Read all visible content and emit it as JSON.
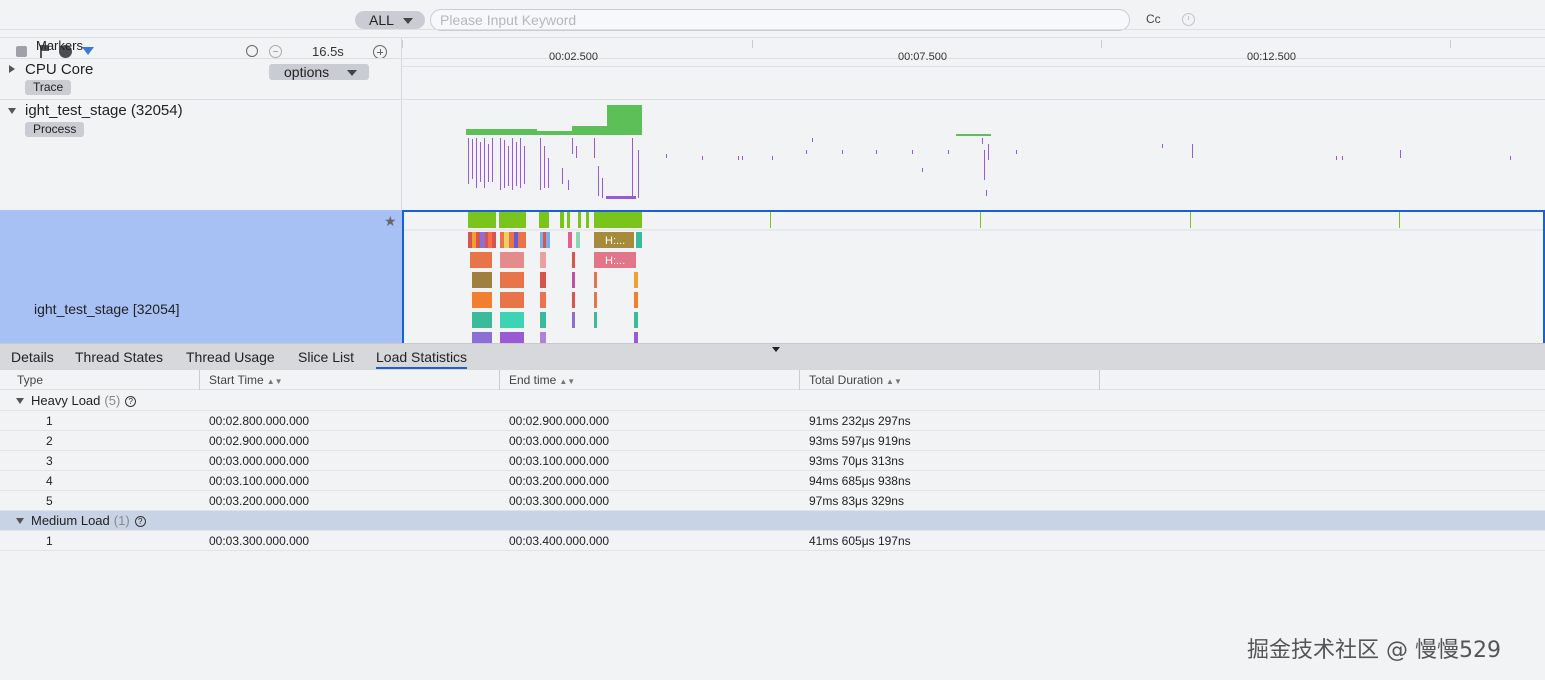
{
  "search": {
    "scope": "ALL",
    "placeholder": "Please Input Keyword",
    "case_label": "Cc"
  },
  "toolbar": {
    "zoom": "16.5s"
  },
  "ruler": {
    "ticks": [
      "00:02.500",
      "00:07.500",
      "00:12.500"
    ]
  },
  "rows": {
    "markers": "Markers",
    "cpu": {
      "title": "CPU Core",
      "tag": "Trace",
      "options": "options"
    },
    "process": {
      "title": "ight_test_stage (32054)",
      "tag": "Process"
    },
    "thread": {
      "title": "ight_test_stage [32054]",
      "slice_label_1": "H:...",
      "slice_label_2": "H:..."
    }
  },
  "tabs": [
    "Details",
    "Thread States",
    "Thread Usage",
    "Slice List",
    "Load Statistics"
  ],
  "table": {
    "columns": [
      "Type",
      "Start Time",
      "End time",
      "Total Duration"
    ],
    "groups": [
      {
        "name": "Heavy Load",
        "count": "(5)",
        "rows": [
          {
            "id": "1",
            "start": "00:02.800.000.000",
            "end": "00:02.900.000.000",
            "duration": "91ms 232μs 297ns"
          },
          {
            "id": "2",
            "start": "00:02.900.000.000",
            "end": "00:03.000.000.000",
            "duration": "93ms 597μs 919ns"
          },
          {
            "id": "3",
            "start": "00:03.000.000.000",
            "end": "00:03.100.000.000",
            "duration": "93ms 70μs 313ns"
          },
          {
            "id": "4",
            "start": "00:03.100.000.000",
            "end": "00:03.200.000.000",
            "duration": "94ms 685μs 938ns"
          },
          {
            "id": "5",
            "start": "00:03.200.000.000",
            "end": "00:03.300.000.000",
            "duration": "97ms 83μs 329ns"
          }
        ]
      },
      {
        "name": "Medium Load",
        "count": "(1)",
        "rows": [
          {
            "id": "1",
            "start": "00:03.300.000.000",
            "end": "00:03.400.000.000",
            "duration": "41ms 605μs 197ns"
          }
        ]
      }
    ]
  },
  "watermark": "掘金技术社区 @ 慢慢529",
  "colors": {
    "accent": "#1b5fd6",
    "selection": "#a8c1f4",
    "cpu_green": "#5cbf57",
    "slice_purple": "#9a5ad6"
  }
}
